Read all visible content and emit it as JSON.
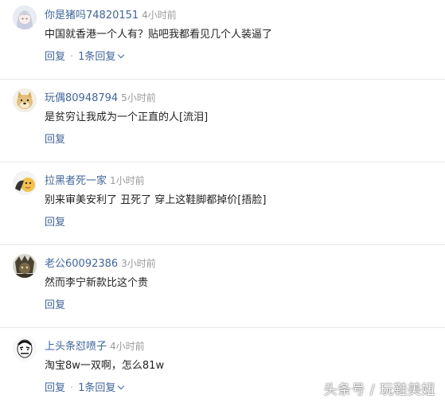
{
  "comments": [
    {
      "user": "你是猪吗74820151",
      "time": "4小时前",
      "text": "中国就香港一个人有？贴吧我都看见几个人装逼了",
      "reply_label": "回复",
      "dot": "·",
      "replies_label": "1条回复",
      "avatar_icon": "anime-girl-avatar-icon"
    },
    {
      "user": "玩偶80948794",
      "time": "5小时前",
      "text": "是贫穷让我成为一个正直的人[流泪]",
      "reply_label": "回复",
      "avatar_icon": "doge-avatar-icon"
    },
    {
      "user": "拉黑者死一家",
      "time": "1小时前",
      "text": "别来审美安利了 丑死了 穿上这鞋脚都掉价[捂脸]",
      "reply_label": "回复",
      "avatar_icon": "cartoon-avatar-icon"
    },
    {
      "user": "老公60092386",
      "time": "3小时前",
      "text": "然而李宁新款比这个贵",
      "reply_label": "回复",
      "avatar_icon": "dark-character-avatar-icon"
    },
    {
      "user": "上头条怼喷子",
      "time": "4小时前",
      "text": "淘宝8w一双啊，怎么81w",
      "reply_label": "回复",
      "dot": "·",
      "replies_label": "1条回复",
      "avatar_icon": "meme-face-avatar-icon"
    }
  ],
  "colors": {
    "username": "#406599",
    "timestamp": "#999999",
    "body_text": "#222222",
    "divider": "#e6e6e6"
  },
  "watermark": "头条号 / 玩鞋美妞"
}
